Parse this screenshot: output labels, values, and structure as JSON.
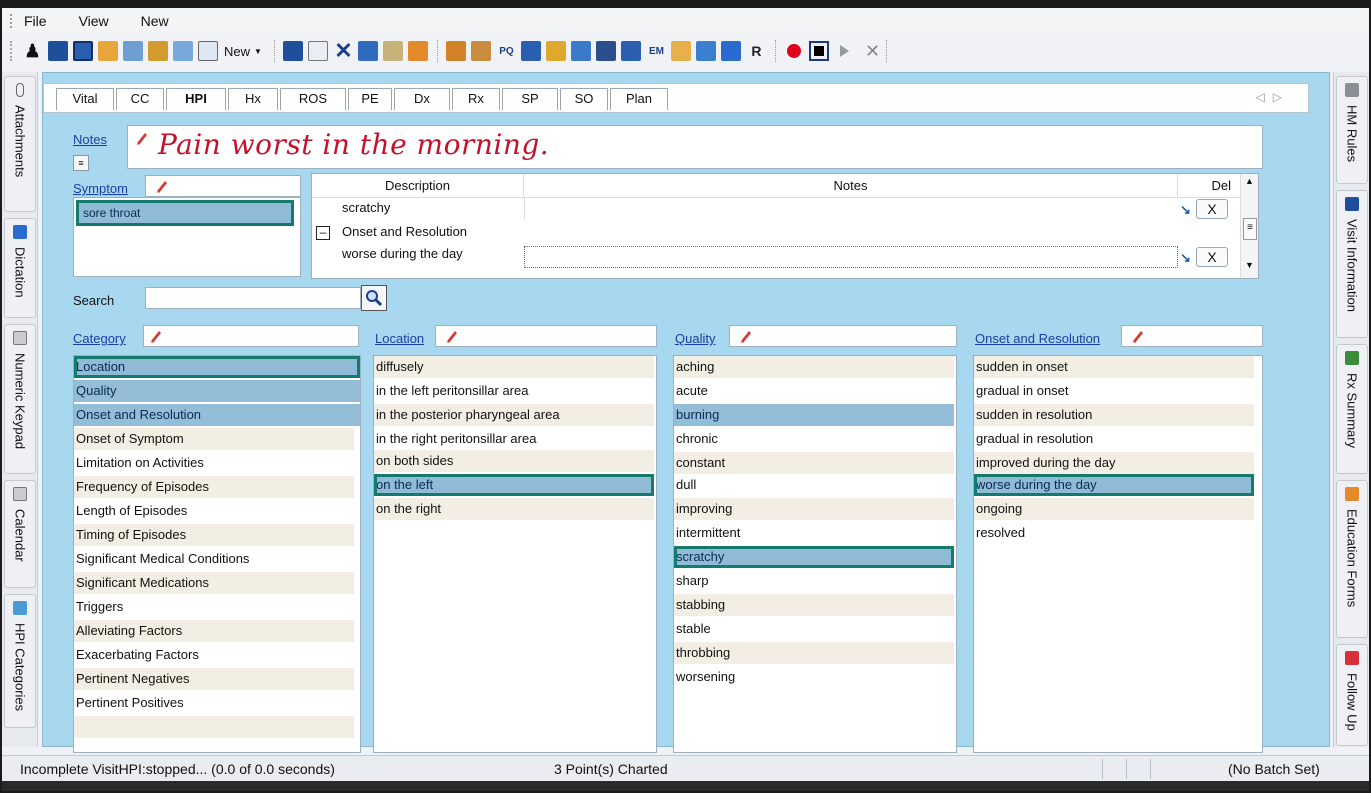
{
  "menu": [
    "File",
    "View",
    "New"
  ],
  "toolbar": {
    "new_label": "New"
  },
  "left_tabs": [
    "Attachments",
    "Dictation",
    "Numeric Keypad",
    "Calendar",
    "HPI Categories"
  ],
  "right_tabs": [
    "HM Rules",
    "Visit Information",
    "Rx Summary",
    "Education Forms",
    "Follow Up"
  ],
  "tabs": [
    "Vital",
    "CC",
    "HPI",
    "Hx",
    "ROS",
    "PE",
    "Dx",
    "Rx",
    "SP",
    "SO",
    "Plan"
  ],
  "active_tab": "HPI",
  "notes": {
    "label": "Notes",
    "text": "Pain worst in the morning."
  },
  "symptom": {
    "label": "Symptom",
    "items": [
      "sore throat"
    ]
  },
  "grid": {
    "headers": {
      "description": "Description",
      "notes": "Notes",
      "del": "Del"
    },
    "rows": [
      {
        "description": "scratchy",
        "notes": ""
      },
      {
        "group": "Onset and Resolution"
      },
      {
        "description": "worse during the day",
        "notes": ""
      }
    ],
    "delete_label": "X"
  },
  "search": {
    "label": "Search",
    "value": ""
  },
  "category": {
    "label": "Category",
    "items": [
      "Location",
      "Quality",
      "Onset and Resolution",
      "Onset of Symptom",
      "Limitation on Activities",
      "Frequency of Episodes",
      "Length of Episodes",
      "Timing of Episodes",
      "Significant Medical Conditions",
      "Significant Medications",
      "Triggers",
      "Alleviating Factors",
      "Exacerbating Factors",
      "Pertinent Negatives",
      "Pertinent Positives"
    ],
    "selected": "Location",
    "highlighted": [
      "Quality",
      "Onset and Resolution"
    ]
  },
  "location": {
    "label": "Location",
    "items": [
      "diffusely",
      "in the left peritonsillar area",
      "in the posterior pharyngeal area",
      "in the right peritonsillar area",
      "on both sides",
      "on the left",
      "on the right"
    ],
    "selected": "on the left"
  },
  "quality": {
    "label": "Quality",
    "items": [
      "aching",
      "acute",
      "burning",
      "chronic",
      "constant",
      "dull",
      "improving",
      "intermittent",
      "scratchy",
      "sharp",
      "stabbing",
      "stable",
      "throbbing",
      "worsening"
    ],
    "selected": "scratchy",
    "highlighted": [
      "burning"
    ]
  },
  "onset": {
    "label": "Onset and Resolution",
    "items": [
      "sudden in onset",
      "gradual in onset",
      "sudden in resolution",
      "gradual in resolution",
      "improved during the day",
      "worse during the day",
      "ongoing",
      "resolved"
    ],
    "selected": "worse during the day"
  },
  "status": {
    "left": "Incomplete VisitHPI:stopped... (0.0 of 0.0 seconds)",
    "center": "3 Point(s) Charted",
    "right": "(No Batch Set)"
  },
  "colors": {
    "panel_bg": "#a7d8ef",
    "selected_border": "#147a6e",
    "notes_ink": "#c4122b",
    "link": "#1b3fa0"
  }
}
